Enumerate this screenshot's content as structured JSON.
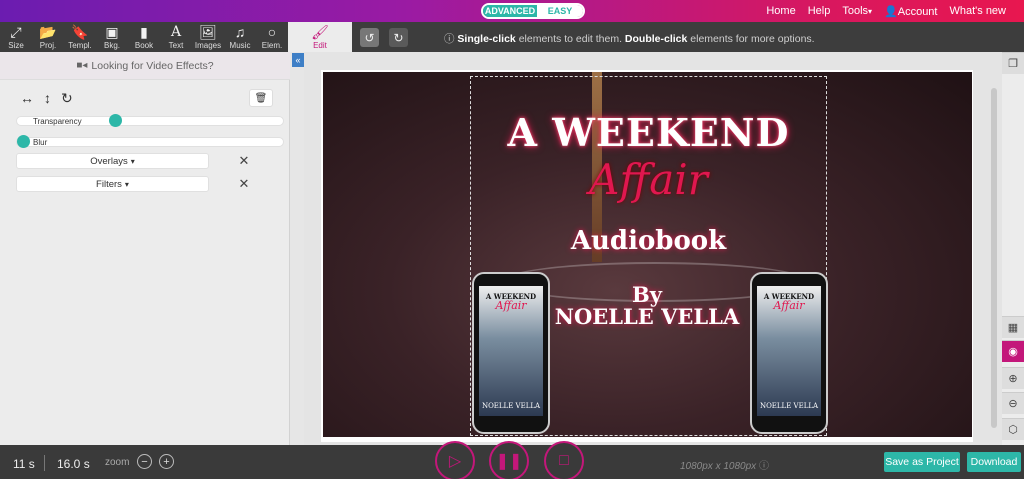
{
  "topbar": {
    "mode_advanced": "ADVANCED",
    "mode_easy": "EASY",
    "nav": [
      "Home",
      "Help",
      "Tools",
      "Account",
      "What's new"
    ]
  },
  "tools": [
    {
      "label": "Size",
      "icon": "resize-icon"
    },
    {
      "label": "Proj.",
      "icon": "folder-icon"
    },
    {
      "label": "Templ.",
      "icon": "bookmark-icon"
    },
    {
      "label": "Bkg.",
      "icon": "background-icon"
    },
    {
      "label": "Book",
      "icon": "book-icon"
    },
    {
      "label": "Text",
      "icon": "text-icon"
    },
    {
      "label": "Images",
      "icon": "image-icon"
    },
    {
      "label": "Music",
      "icon": "music-icon"
    },
    {
      "label": "Elem.",
      "icon": "circle-icon"
    }
  ],
  "edit_tool": {
    "label": "Edit"
  },
  "hint": {
    "part1": "Single-click",
    "part2": " elements to edit them. ",
    "part3": "Double-click",
    "part4": " elements for more options."
  },
  "panel": {
    "video_effects": "Looking for Video Effects?",
    "transparency_label": "Transparency",
    "blur_label": "Blur",
    "overlays_label": "Overlays",
    "filters_label": "Filters",
    "transparency_value": 0.36,
    "blur_value": 0.0
  },
  "artwork": {
    "line1": "A WEEKEND",
    "line2": "Affair",
    "line3": "Audiobook",
    "line4": "By",
    "line5": "NOELLE VELLA",
    "cover_title": "A WEEKEND",
    "cover_script": "Affair",
    "cover_author": "NOELLE VELLA"
  },
  "bottom": {
    "current_time": "11 s",
    "duration": "16.0 s",
    "zoom_label": "zoom",
    "dimensions": "1080px x 1080px",
    "save_label": "Save as Project",
    "download_label": "Download"
  },
  "colors": {
    "accent": "#2db7a8",
    "brand": "#c3177a",
    "topbar_start": "#6b1cb0",
    "topbar_end": "#e8174f"
  }
}
